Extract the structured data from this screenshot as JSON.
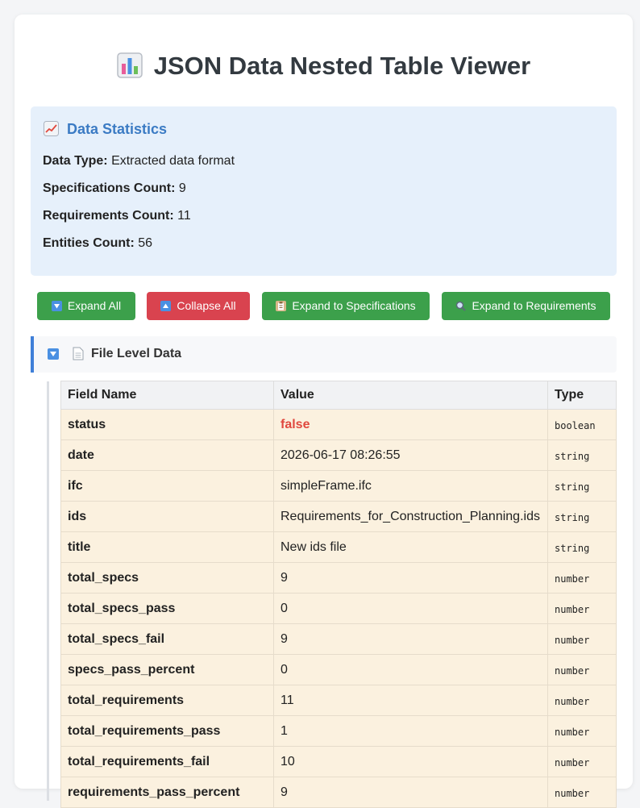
{
  "page": {
    "title": "JSON Data Nested Table Viewer",
    "title_icon": "bar-chart-icon"
  },
  "stats": {
    "title": "Data Statistics",
    "title_icon": "chart-increasing-icon",
    "lines": [
      {
        "label": "Data Type:",
        "value": "Extracted data format"
      },
      {
        "label": "Specifications Count:",
        "value": "9"
      },
      {
        "label": "Requirements Count:",
        "value": "11"
      },
      {
        "label": "Entities Count:",
        "value": "56"
      }
    ]
  },
  "buttons": {
    "expand_all": "Expand All",
    "collapse_all": "Collapse All",
    "expand_specs": "Expand to Specifications",
    "expand_reqs": "Expand to Requirements"
  },
  "section": {
    "title": "File Level Data",
    "icon": "document-icon"
  },
  "table": {
    "headers": [
      "Field Name",
      "Value",
      "Type"
    ],
    "rows": [
      {
        "field": "status",
        "value": "false",
        "type": "boolean"
      },
      {
        "field": "date",
        "value": "2026-06-17 08:26:55",
        "type": "string"
      },
      {
        "field": "ifc",
        "value": "simpleFrame.ifc",
        "type": "string"
      },
      {
        "field": "ids",
        "value": "Requirements_for_Construction_Planning.ids",
        "type": "string"
      },
      {
        "field": "title",
        "value": "New ids file",
        "type": "string"
      },
      {
        "field": "total_specs",
        "value": "9",
        "type": "number"
      },
      {
        "field": "total_specs_pass",
        "value": "0",
        "type": "number"
      },
      {
        "field": "total_specs_fail",
        "value": "9",
        "type": "number"
      },
      {
        "field": "specs_pass_percent",
        "value": "0",
        "type": "number"
      },
      {
        "field": "total_requirements",
        "value": "11",
        "type": "number"
      },
      {
        "field": "total_requirements_pass",
        "value": "1",
        "type": "number"
      },
      {
        "field": "total_requirements_fail",
        "value": "10",
        "type": "number"
      },
      {
        "field": "requirements_pass_percent",
        "value": "9",
        "type": "number"
      }
    ]
  },
  "colors": {
    "stats_title": "#3b7bc4",
    "button_green": "#3ca04b",
    "button_red": "#d9434f",
    "false_value": "#e0483e",
    "row_bg": "#fbf1df"
  }
}
